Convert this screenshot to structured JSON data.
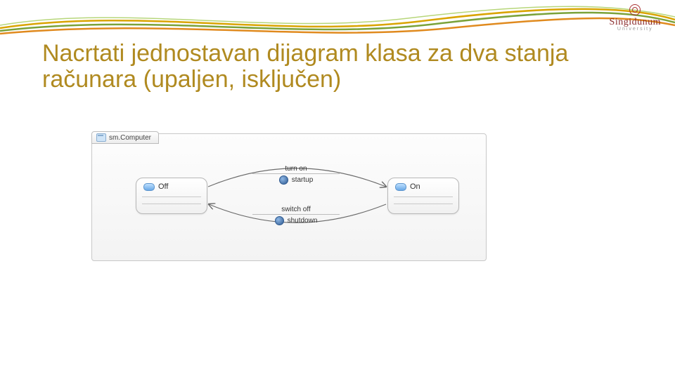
{
  "logo": {
    "name": "Singidunum",
    "sub": "University"
  },
  "title": "Nacrtati jednostavan dijagram klasa za dva stanja računara (upaljen, isključen)",
  "diagram": {
    "tab_label": "sm.Computer",
    "states": {
      "off": "Off",
      "on": "On"
    },
    "transitions": {
      "on": {
        "trigger": "turn on",
        "effect": "startup"
      },
      "off": {
        "trigger": "switch off",
        "effect": "shutdown"
      }
    }
  }
}
